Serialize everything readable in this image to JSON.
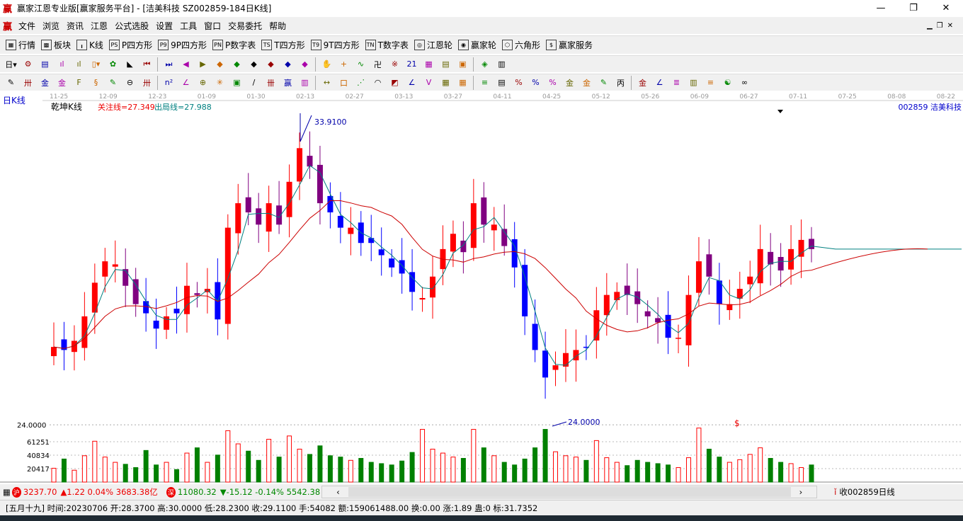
{
  "window": {
    "title": "赢家江恩专业版[赢家服务平台] - [洁美科技  SZ002859-184日K线]",
    "logo": "赢",
    "minimize": "—",
    "restore": "❐",
    "close": "✕"
  },
  "menu": [
    "文件",
    "浏览",
    "资讯",
    "江恩",
    "公式选股",
    "设置",
    "工具",
    "窗口",
    "交易委托",
    "帮助"
  ],
  "toolbar1": [
    {
      "icon": "grid-icon",
      "glyph": "▦",
      "label": "行情"
    },
    {
      "icon": "blocks-icon",
      "glyph": "▩",
      "label": "板块"
    },
    {
      "icon": "kline-icon",
      "glyph": "╻",
      "label": "K线"
    },
    {
      "icon": "ps-icon",
      "glyph": "PS",
      "label": "P四方形"
    },
    {
      "icon": "p9-icon",
      "glyph": "P9",
      "label": "9P四方形"
    },
    {
      "icon": "pn-icon",
      "glyph": "PN",
      "label": "P数字表"
    },
    {
      "icon": "ts-icon",
      "glyph": "TS",
      "label": "T四方形"
    },
    {
      "icon": "t9-icon",
      "glyph": "T9",
      "label": "9T四方形"
    },
    {
      "icon": "tn-icon",
      "glyph": "TN",
      "label": "T数字表"
    },
    {
      "icon": "gann-wheel-icon",
      "glyph": "◎",
      "label": "江恩轮"
    },
    {
      "icon": "winner-wheel-icon",
      "glyph": "◉",
      "label": "赢家轮"
    },
    {
      "icon": "hexagon-icon",
      "glyph": "⬡",
      "label": "六角形"
    },
    {
      "icon": "dollar-icon",
      "glyph": "$",
      "label": "赢家服务"
    }
  ],
  "toolbar2": [
    [
      "period-icon",
      "日▾"
    ],
    [
      "cycle-icon",
      "⚙"
    ],
    [
      "doc-icon",
      "▤"
    ],
    [
      "chart3-icon",
      "ıl"
    ],
    [
      "chart9-icon",
      "ıl"
    ],
    [
      "candle-icon",
      "▯▾"
    ],
    [
      "gann-icon",
      "✿"
    ],
    [
      "fan-icon",
      "◣"
    ],
    [
      "first-icon",
      "⏮"
    ],
    [
      "last-icon",
      "⏭"
    ],
    [
      "left-icon",
      "◀"
    ],
    [
      "right-icon",
      "▶"
    ],
    [
      "arrow-left-icon",
      "◆"
    ],
    [
      "arrow-right-icon",
      "◆"
    ],
    [
      "expand-icon",
      "◆"
    ],
    [
      "shrink-icon",
      "◆"
    ],
    [
      "zoom-in-icon",
      "◆"
    ],
    [
      "zoom-out-icon",
      "◆"
    ],
    [
      "hand-icon",
      "✋"
    ],
    [
      "cross-icon",
      "+"
    ],
    [
      "line-icon",
      "∿"
    ],
    [
      "stamp-icon",
      "卍"
    ],
    [
      "pattern-icon",
      "※"
    ],
    [
      "calendar-icon",
      "21"
    ],
    [
      "calculator-icon",
      "▦"
    ],
    [
      "notes-icon",
      "▤"
    ],
    [
      "save-icon",
      "▣"
    ],
    [
      "network-icon",
      "◈"
    ],
    [
      "print-icon",
      "▥"
    ]
  ],
  "toolbar3": [
    [
      "pen-icon",
      "✎"
    ],
    [
      "hash-icon",
      "卅"
    ],
    [
      "gold1-icon",
      "金"
    ],
    [
      "gold2-icon",
      "金"
    ],
    [
      "fib-icon",
      "F"
    ],
    [
      "spiral-icon",
      "§"
    ],
    [
      "brush-icon",
      "✎"
    ],
    [
      "circle-ruler-icon",
      "⊖"
    ],
    [
      "lines-icon",
      "卅"
    ],
    [
      "n2-icon",
      "n²"
    ],
    [
      "angle-icon",
      "∠"
    ],
    [
      "target-icon",
      "⊕"
    ],
    [
      "star-icon",
      "✳"
    ],
    [
      "box-icon",
      "▣"
    ],
    [
      "slash-icon",
      "/"
    ],
    [
      "time-icon",
      "卌"
    ],
    [
      "win-icon",
      "赢"
    ],
    [
      "ruler-icon",
      "▥"
    ],
    [
      "width-icon",
      "↔"
    ],
    [
      "rect-icon",
      "口"
    ],
    [
      "fan-lines-icon",
      "⋰"
    ],
    [
      "arc-icon",
      "◠"
    ],
    [
      "square-fan-icon",
      "◩"
    ],
    [
      "angle2-icon",
      "∠"
    ],
    [
      "v-icon",
      "V"
    ],
    [
      "gridbox-icon",
      "▦"
    ],
    [
      "gridbox2-icon",
      "▦"
    ],
    [
      "parallel-icon",
      "≡"
    ],
    [
      "table-icon",
      "▤"
    ],
    [
      "pct-red-icon",
      "%"
    ],
    [
      "pct-icon",
      "%"
    ],
    [
      "pct-list-icon",
      "%"
    ],
    [
      "gold3-icon",
      "金"
    ],
    [
      "gold4-icon",
      "金"
    ],
    [
      "pen2-icon",
      "✎"
    ],
    [
      "ruler2-icon",
      "丙"
    ],
    [
      "gold5-icon",
      "金"
    ],
    [
      "tri-icon",
      "∠"
    ],
    [
      "stripe-icon",
      "≣"
    ],
    [
      "bars-icon",
      "▥"
    ],
    [
      "levels-icon",
      "≡"
    ],
    [
      "yinyang-icon",
      "☯"
    ],
    [
      "infinity-icon",
      "∞"
    ]
  ],
  "chart": {
    "period": "日K线",
    "indicator": "乾坤K线",
    "focus_line": "关注线=27.349",
    "exit_line": "出局线=27.988",
    "stock": "002859  洁美科技",
    "high_label": "33.9100",
    "low_label": "24.0000",
    "low_axis": "24.0000",
    "dollar_marker": "$",
    "dates": [
      "11-25",
      "12-09",
      "12-23",
      "01-09",
      "01-30",
      "02-13",
      "02-27",
      "03-13",
      "03-27",
      "04-11",
      "04-25",
      "05-12",
      "05-26",
      "06-09",
      "06-27",
      "07-11",
      "07-25",
      "08-08",
      "08-22"
    ],
    "vol_ticks": [
      "61251",
      "40834",
      "20417"
    ],
    "colors": {
      "up": "#ff0000",
      "down": "#0000ff",
      "weak": "#800080",
      "ma_short": "#008080",
      "ma_long": "#cc0000",
      "vol_up": "#ff0000",
      "vol_down": "#008000"
    }
  },
  "chart_data": {
    "type": "candlestick",
    "price_range": [
      24.0,
      33.91
    ],
    "closes": [
      26.5,
      26.4,
      26.7,
      27.5,
      28.6,
      29.3,
      29.2,
      28.5,
      27.9,
      27.6,
      27.1,
      27.5,
      27.6,
      28.5,
      28.2,
      28.4,
      27.4,
      30.4,
      31.2,
      30.9,
      30.5,
      31.2,
      30.5,
      31.9,
      33.0,
      32.4,
      31.2,
      30.9,
      30.4,
      30.4,
      29.9,
      29.9,
      29.5,
      29.1,
      28.9,
      28.3,
      28.1,
      28.8,
      29.7,
      30.2,
      29.6,
      31.2,
      30.5,
      30.5,
      29.8,
      29.1,
      27.5,
      26.4,
      25.5,
      25.9,
      26.3,
      26.4,
      26.5,
      27.7,
      28.2,
      28.3,
      28.2,
      27.9,
      27.5,
      27.3,
      26.8,
      26.8,
      28.2,
      29.3,
      28.8,
      27.9,
      27.9,
      28.4,
      28.8,
      29.7,
      29.2,
      29.0,
      29.7,
      30.0,
      29.7
    ],
    "volumes": [
      21000,
      35000,
      18000,
      40000,
      62000,
      38000,
      30000,
      27000,
      22000,
      48000,
      26000,
      30000,
      19000,
      44000,
      52000,
      30000,
      41000,
      78000,
      58000,
      47000,
      33000,
      65000,
      38000,
      70000,
      50000,
      42000,
      55000,
      40000,
      38000,
      33000,
      36000,
      30000,
      28000,
      26000,
      32000,
      45000,
      80000,
      50000,
      44000,
      38000,
      36000,
      80000,
      52000,
      40000,
      30000,
      26000,
      35000,
      52000,
      80000,
      46000,
      40000,
      38000,
      33000,
      63000,
      37000,
      30000,
      25000,
      33000,
      30000,
      28000,
      26000,
      22000,
      37000,
      82000,
      50000,
      38000,
      30000,
      34000,
      42000,
      52000,
      36000,
      30000,
      28000,
      22000,
      26000
    ]
  },
  "status": {
    "sh_index": "3237.70",
    "sh_change": "▲1.22 0.04% 3683.38亿",
    "sz_index": "11080.32",
    "sz_change": "▼-15.12 -0.14% 5542.38",
    "sh_badge": "沪",
    "sz_badge": "深",
    "scroll_left": "‹",
    "scroll_right": "›",
    "right_text": "收002859日线"
  },
  "info": "[五月十九] 时间:20230706 开:28.3700 高:30.0000 低:28.2300 收:29.1100 手:54082 额:159061488.00 换:0.00 涨:1.89 蛊:0 标:31.7352"
}
